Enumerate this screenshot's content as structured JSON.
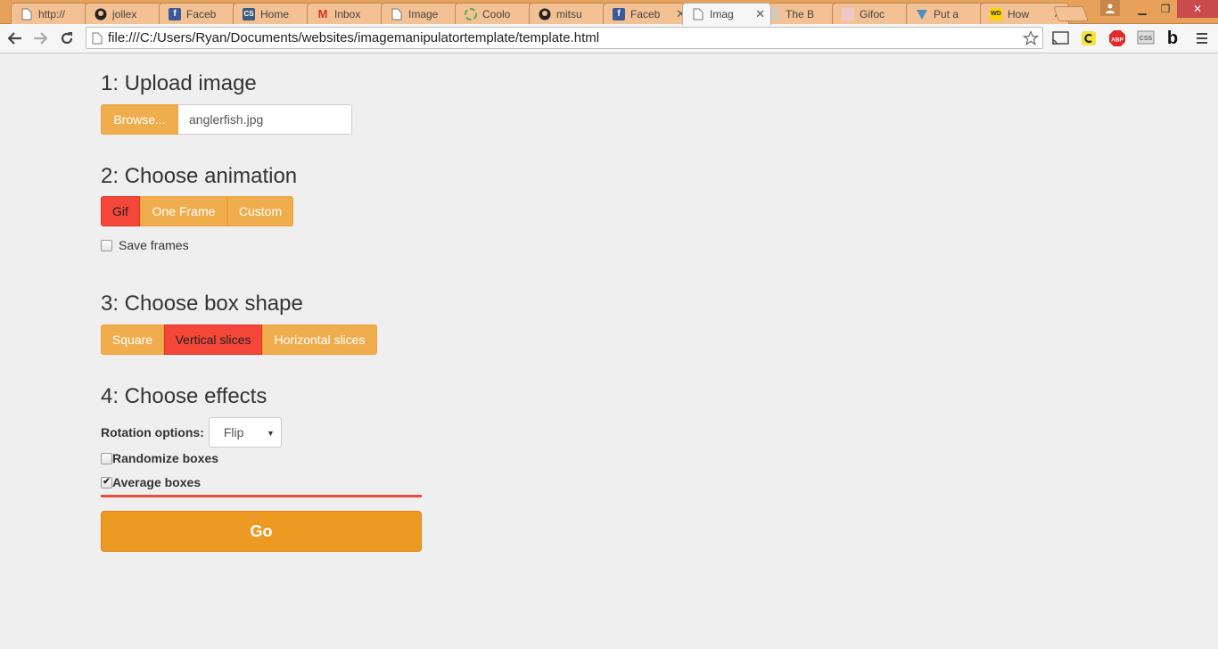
{
  "browser": {
    "tabs": [
      {
        "title": "http://",
        "icon": "page-icon",
        "active": false
      },
      {
        "title": "jollex",
        "icon": "github-icon",
        "active": false
      },
      {
        "title": "Faceb",
        "icon": "facebook-icon",
        "active": false
      },
      {
        "title": "Home",
        "icon": "cs-icon",
        "active": false
      },
      {
        "title": "Inbox",
        "icon": "gmail-icon",
        "active": false
      },
      {
        "title": "Image",
        "icon": "page-icon",
        "active": false
      },
      {
        "title": "Coolo",
        "icon": "coolors-icon",
        "active": false
      },
      {
        "title": "mitsu",
        "icon": "github-icon",
        "active": false
      },
      {
        "title": "Faceb",
        "icon": "facebook-icon",
        "active": false
      },
      {
        "title": "Imag",
        "icon": "page-icon",
        "active": true
      },
      {
        "title": "The B",
        "icon": "bird-icon",
        "active": false
      },
      {
        "title": "Gifoc",
        "icon": "gifoc-icon",
        "active": false
      },
      {
        "title": "Put a",
        "icon": "arrow-icon",
        "active": false
      },
      {
        "title": "How",
        "icon": "wd-icon",
        "active": false
      }
    ],
    "favicon_text": {
      "cs": "CS",
      "gmail": "M",
      "wd": "WD"
    },
    "address": "file:///C:/Users/Ryan/Documents/websites/imagemanipulatortemplate/template.html",
    "extensions": {
      "abp": "ABP",
      "css": "CSS",
      "b": "b"
    }
  },
  "page": {
    "upload": {
      "heading": "1: Upload image",
      "browse_label": "Browse...",
      "filename": "anglerfish.jpg"
    },
    "animation": {
      "heading": "2: Choose animation",
      "options": [
        {
          "label": "Gif",
          "active": true
        },
        {
          "label": "One Frame",
          "active": false
        },
        {
          "label": "Custom",
          "active": false
        }
      ],
      "save_frames_label": "Save frames",
      "save_frames_checked": false
    },
    "shape": {
      "heading": "3: Choose box shape",
      "options": [
        {
          "label": "Square",
          "active": false
        },
        {
          "label": "Vertical slices",
          "active": true
        },
        {
          "label": "Horizontal slices",
          "active": false
        }
      ]
    },
    "effects": {
      "heading": "4: Choose effects",
      "rotation_label": "Rotation options:",
      "rotation_value": "Flip",
      "randomize_label": "Randomize boxes",
      "randomize_checked": false,
      "average_label": "Average boxes",
      "average_checked": true
    },
    "go_label": "Go"
  },
  "colors": {
    "accent_orange": "#f0ad4e",
    "active_red": "#f4473a",
    "go_orange": "#ec9a22",
    "divider_red": "#e74c3c",
    "browser_frame": "#e8a15a"
  }
}
